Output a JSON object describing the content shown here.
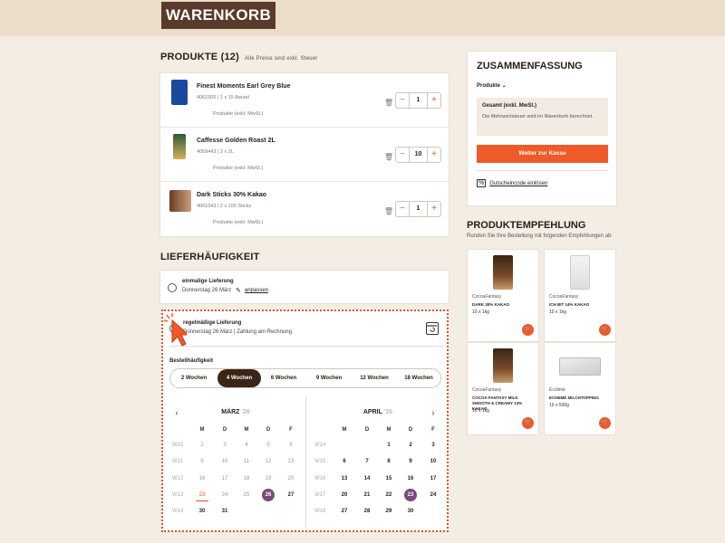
{
  "header": {
    "title": "WARENKORB"
  },
  "products_section": {
    "title": "PRODUKTE (12)",
    "note": "Alle Preise sind exkl. Steuer",
    "items": [
      {
        "name": "Finest Moments Earl Grey Blue",
        "sku": "4061505 | 1 x 15 Beutel",
        "note": "Produkte (exkl. MwSt.)",
        "qty": "1"
      },
      {
        "name": "Caffesse Golden Roast 2L",
        "sku": "4059443 | 2 x 2L",
        "note": "Produkte (exkl. MwSt.)",
        "qty": "10"
      },
      {
        "name": "Dark Sticks 30% Kakao",
        "sku": "4061043 | 2 x 100 Sticks",
        "note": "Produkte (exkl. MwSt.)",
        "qty": "1"
      }
    ]
  },
  "delivery": {
    "title": "LIEFERHÄUFIGKEIT",
    "once": {
      "label": "einmalige Lieferung",
      "date": "Donnerstag 26 März",
      "edit": "anpassen"
    },
    "regular": {
      "label": "regelmäßige Lieferung",
      "info": "Donnerstag 26 März  |  Zahlung am Rechnung"
    },
    "freq_label": "Bestellhäufigkeit",
    "frequencies": [
      "2 Wochen",
      "4 Wochen",
      "6 Wochen",
      "9 Wochen",
      "12 Wochen",
      "18 Wochen"
    ],
    "selected_frequency": "4 Wochen"
  },
  "calendars": [
    {
      "month": "MÄRZ",
      "year": "'26",
      "weekdays": [
        "M",
        "D",
        "M",
        "D",
        "F"
      ],
      "weeks": [
        {
          "label": "W10",
          "days": [
            "2",
            "3",
            "4",
            "5",
            "6"
          ]
        },
        {
          "label": "W11",
          "days": [
            "9",
            "10",
            "11",
            "12",
            "13"
          ]
        },
        {
          "label": "W12",
          "days": [
            "16",
            "17",
            "18",
            "19",
            "20"
          ]
        },
        {
          "label": "W13",
          "days": [
            "23",
            "24",
            "25",
            "26",
            "27"
          ]
        },
        {
          "label": "W14",
          "days": [
            "30",
            "31",
            "",
            "",
            ""
          ]
        }
      ]
    },
    {
      "month": "APRIL",
      "year": "'26",
      "weekdays": [
        "M",
        "D",
        "M",
        "D",
        "F"
      ],
      "weeks": [
        {
          "label": "W14",
          "days": [
            "",
            "",
            "1",
            "2",
            "3"
          ]
        },
        {
          "label": "W15",
          "days": [
            "6",
            "7",
            "8",
            "9",
            "10"
          ]
        },
        {
          "label": "W16",
          "days": [
            "13",
            "14",
            "15",
            "16",
            "17"
          ]
        },
        {
          "label": "W17",
          "days": [
            "20",
            "21",
            "22",
            "23",
            "24"
          ]
        },
        {
          "label": "W18",
          "days": [
            "27",
            "28",
            "29",
            "30",
            ""
          ]
        }
      ]
    }
  ],
  "summary": {
    "title": "ZUSAMMENFASSUNG",
    "products_toggle": "Produkte",
    "total_label": "Gesamt (exkl. MwSt.)",
    "vat_note": "Die Mehrwertsteuer wird im Warenkorb berechnet.",
    "checkout": "Weiter zur Kasse",
    "coupon": "Gutscheincode einlösen"
  },
  "recommendations": {
    "title": "PRODUKTEMPFEHLUNG",
    "subtitle": "Runden Sie Ihre Bestellung mit folgenden Empfehlungen ab",
    "items": [
      {
        "brand": "CocoaFantasy",
        "name": "DARK 30% KAKAO",
        "size": "10 x 1kg"
      },
      {
        "brand": "CocoaFantasy",
        "name": "ICH BIT 14% KAKAO",
        "size": "10 x 1kg"
      },
      {
        "brand": "CocoaFantasy",
        "name": "COCOA FANTASY MILK SMOOTH & CREAMY 14% KAKAO",
        "size": "10 x 1kg"
      },
      {
        "brand": "Ecolimé",
        "name": "ECHEME MILCHTOPPING",
        "size": "10 x 500g"
      }
    ]
  },
  "colors": {
    "accent": "#f05a28",
    "brand": "#5a3a2a",
    "highlight": "#7a4a7a",
    "selected_freq": "#3a2516"
  }
}
